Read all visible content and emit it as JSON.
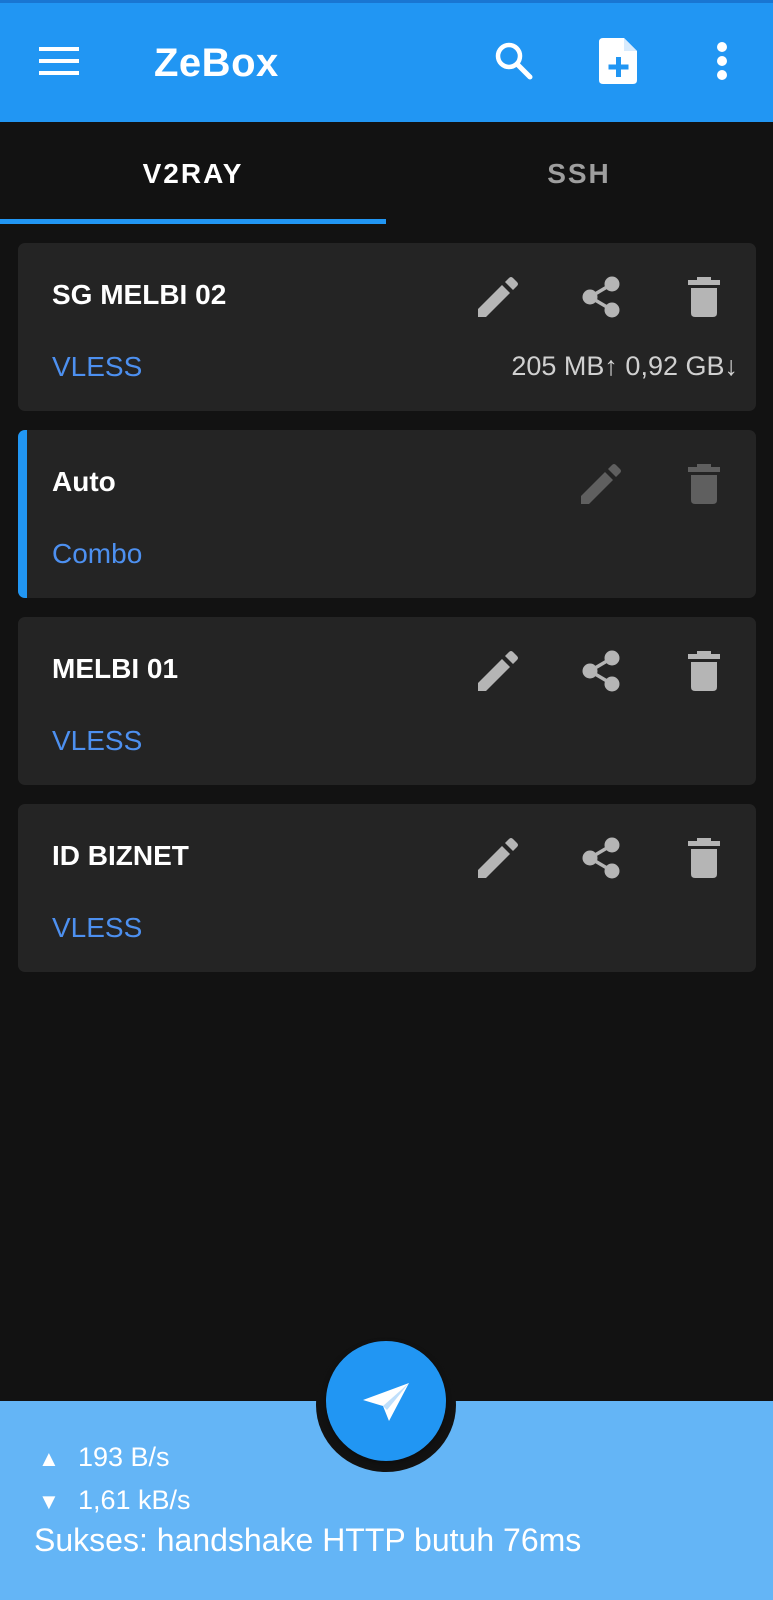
{
  "appbar": {
    "title": "ZeBox",
    "icons": [
      "menu-icon",
      "search-icon",
      "add-file-icon",
      "more-vert-icon"
    ]
  },
  "tabs": [
    {
      "label": "V2RAY",
      "active": true
    },
    {
      "label": "SSH",
      "active": false
    }
  ],
  "profiles": [
    {
      "name": "SG MELBI 02",
      "type": "VLESS",
      "traffic": "205 MB↑ 0,92 GB↓",
      "selected": false,
      "shareable": true
    },
    {
      "name": "Auto",
      "type": "Combo",
      "traffic": "",
      "selected": true,
      "shareable": false
    },
    {
      "name": "MELBI 01",
      "type": "VLESS",
      "traffic": "",
      "selected": false,
      "shareable": true
    },
    {
      "name": "ID BIZNET",
      "type": "VLESS",
      "traffic": "",
      "selected": false,
      "shareable": true
    }
  ],
  "status": {
    "upload_arrow": "▲",
    "upload_speed": "193 B/s",
    "download_arrow": "▼",
    "download_speed": "1,61 kB/s",
    "message": "Sukses: handshake HTTP butuh 76ms"
  },
  "colors": {
    "primary": "#2196f3",
    "bottom_bar": "#64b5f6",
    "protocol_text": "#4d90f0",
    "background": "#121212",
    "card": "#242424"
  }
}
